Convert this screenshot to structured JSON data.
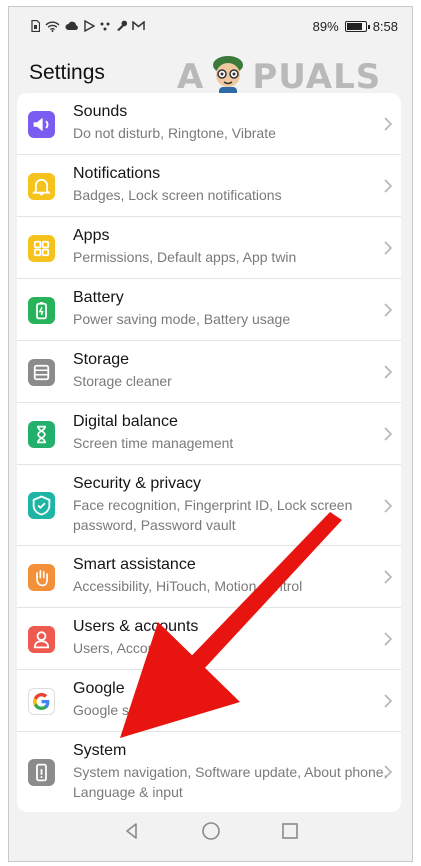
{
  "status_bar": {
    "battery_percent": "89%",
    "time": "8:58",
    "icons": [
      "sim-icon",
      "wifi-icon",
      "cloud-icon",
      "play-icon",
      "dots-icon",
      "wrench-icon",
      "gmail-icon"
    ]
  },
  "watermark": {
    "left": "A",
    "right": "PUALS"
  },
  "header": {
    "title": "Settings"
  },
  "settings": [
    {
      "label": "Sounds",
      "sub": "Do not disturb, Ringtone, Vibrate",
      "color": "#7b5cf0",
      "icon": "speaker-icon"
    },
    {
      "label": "Notifications",
      "sub": "Badges, Lock screen notifications",
      "color": "#f5c31b",
      "icon": "bell-icon"
    },
    {
      "label": "Apps",
      "sub": "Permissions, Default apps, App twin",
      "color": "#f5c31b",
      "icon": "apps-grid-icon"
    },
    {
      "label": "Battery",
      "sub": "Power saving mode, Battery usage",
      "color": "#27b35a",
      "icon": "battery-icon"
    },
    {
      "label": "Storage",
      "sub": "Storage cleaner",
      "color": "#8b8b8b",
      "icon": "storage-icon"
    },
    {
      "label": "Digital balance",
      "sub": "Screen time management",
      "color": "#23b06c",
      "icon": "hourglass-icon"
    },
    {
      "label": "Security & privacy",
      "sub": "Face recognition, Fingerprint ID, Lock screen password, Password vault",
      "color": "#1fb5a4",
      "icon": "shield-icon"
    },
    {
      "label": "Smart assistance",
      "sub": "Accessibility, HiTouch, Motion control",
      "color": "#f3913a",
      "icon": "hand-icon"
    },
    {
      "label": "Users & accounts",
      "sub": "Users, Accounts",
      "color": "#ee5a4f",
      "icon": "user-icon"
    },
    {
      "label": "Google",
      "sub": "Google services",
      "color": "#ffffff",
      "icon": "google-icon"
    },
    {
      "label": "System",
      "sub": "System navigation, Software update, About phone, Language & input",
      "color": "#8b8b8b",
      "icon": "phone-info-icon"
    }
  ],
  "nav": {
    "items": [
      "back-icon",
      "home-icon",
      "recents-icon"
    ]
  },
  "annotation": {
    "color": "#e8140f"
  }
}
